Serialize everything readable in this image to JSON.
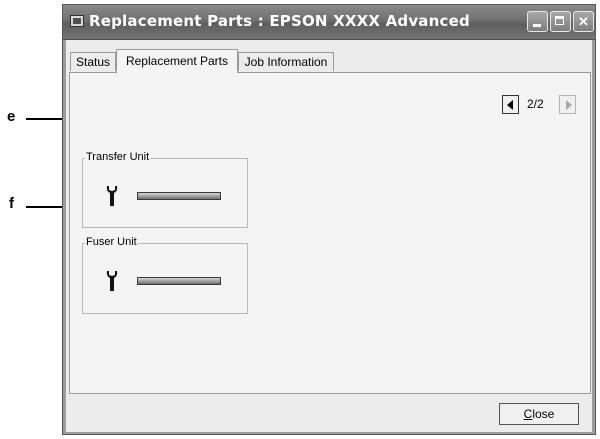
{
  "window": {
    "title": "Replacement Parts : EPSON XXXX Advanced"
  },
  "tabs": [
    {
      "label": "Status",
      "selected": false
    },
    {
      "label": "Replacement Parts",
      "selected": true
    },
    {
      "label": "Job Information",
      "selected": false
    }
  ],
  "pager": {
    "current": "2/2",
    "prev_icon": "left-arrow-icon",
    "next_icon": "right-arrow-icon"
  },
  "units": [
    {
      "label": "Transfer Unit",
      "icon": "wrench-icon",
      "level": 1.0
    },
    {
      "label": "Fuser Unit",
      "icon": "wrench-icon",
      "level": 1.0
    }
  ],
  "callouts": {
    "e": "e",
    "f": "f"
  },
  "buttons": {
    "close_first": "C",
    "close_rest": "lose"
  },
  "colors": {
    "titlebar": "#6f6f6f",
    "panel": "#f4f4f4"
  }
}
